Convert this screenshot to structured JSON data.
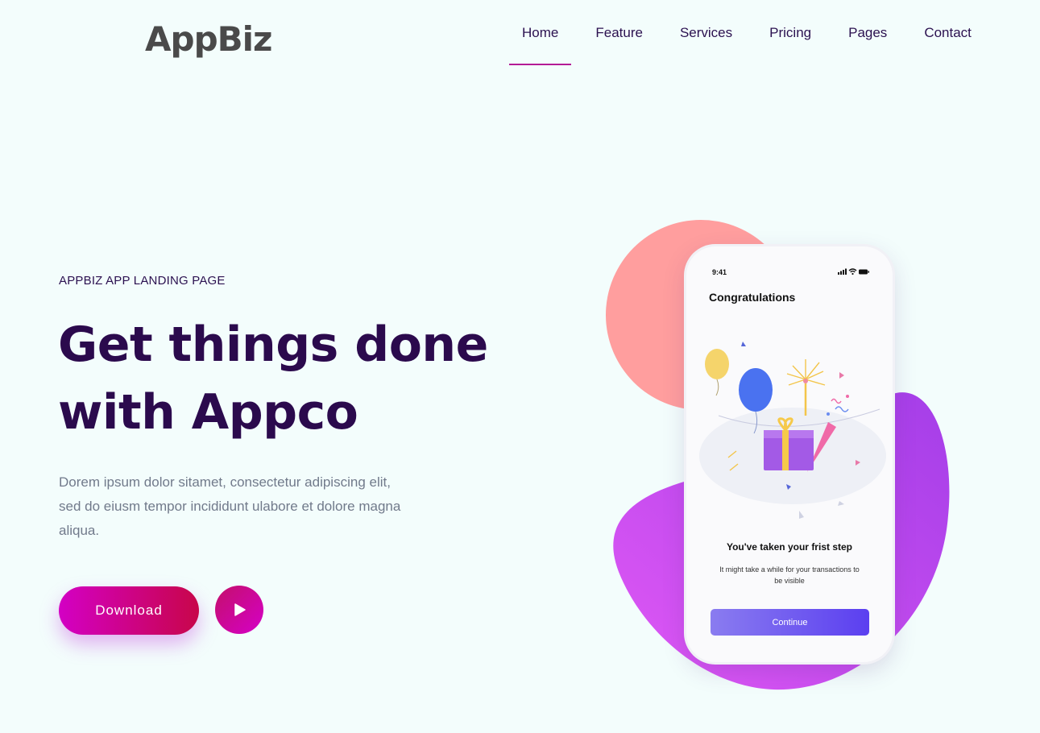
{
  "brand": {
    "name": "AppBiz"
  },
  "nav": {
    "items": [
      {
        "label": "Home",
        "active": true
      },
      {
        "label": "Feature",
        "active": false
      },
      {
        "label": "Services",
        "active": false
      },
      {
        "label": "Pricing",
        "active": false
      },
      {
        "label": "Pages",
        "active": false
      },
      {
        "label": "Contact",
        "active": false
      }
    ],
    "active_color": "#b31b95"
  },
  "hero": {
    "eyebrow": "APPBIZ APP LANDING PAGE",
    "headline_line1": "Get things done",
    "headline_line2": "with Appco",
    "description": "Dorem ipsum dolor sitamet, consectetur adipiscing elit, sed do eiusm tempor incididunt ulabore et dolore magna aliqua.",
    "download_label": "Download",
    "play_icon": "play-icon"
  },
  "phone": {
    "time": "9:41",
    "status_icons": [
      "signal-icon",
      "wifi-icon",
      "battery-icon"
    ],
    "title": "Congratulations",
    "step_text": "You've taken your frist step",
    "note": "It might take a while for your transactions to be visible",
    "continue_label": "Continue"
  },
  "colors": {
    "background": "#f3fdfc",
    "heading": "#2b0a4d",
    "blob_pink": "#ff9e9e",
    "blob_purple": "#c84cf0",
    "button_gradient_start": "#d300c4",
    "button_gradient_end": "#c8064a"
  }
}
